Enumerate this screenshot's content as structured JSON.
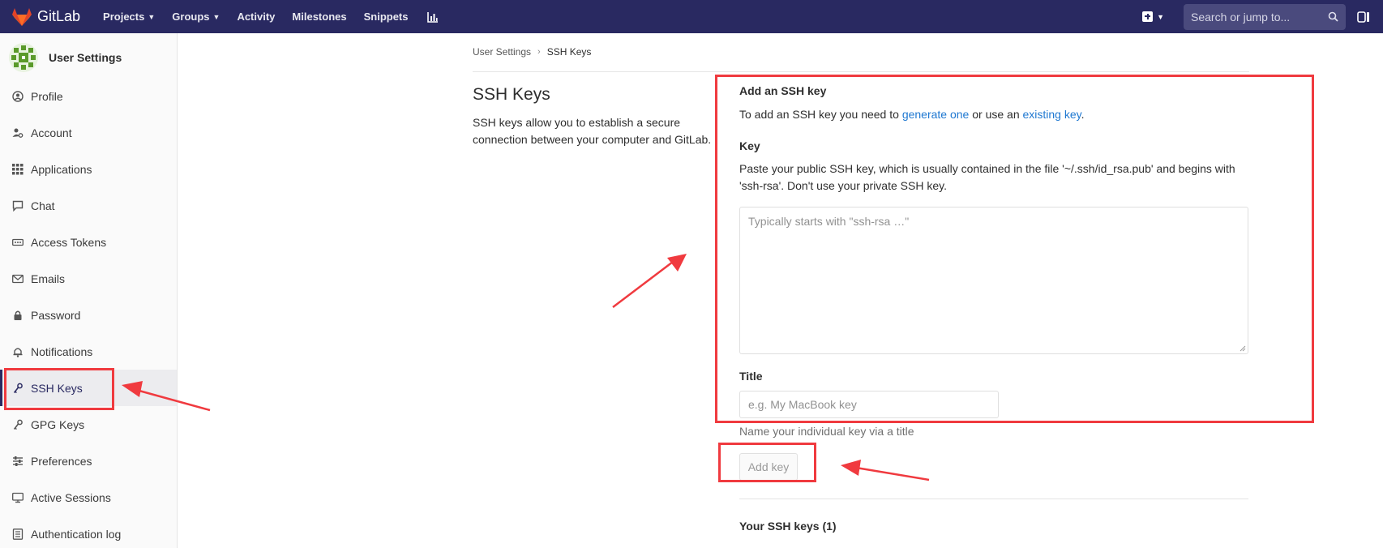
{
  "topnav": {
    "brand": "GitLab",
    "links": [
      "Projects",
      "Groups",
      "Activity",
      "Milestones",
      "Snippets"
    ],
    "search_placeholder": "Search or jump to..."
  },
  "sidebar": {
    "title": "User Settings",
    "items": [
      {
        "label": "Profile",
        "icon": "profile-icon"
      },
      {
        "label": "Account",
        "icon": "account-icon"
      },
      {
        "label": "Applications",
        "icon": "applications-icon"
      },
      {
        "label": "Chat",
        "icon": "chat-icon"
      },
      {
        "label": "Access Tokens",
        "icon": "access-tokens-icon"
      },
      {
        "label": "Emails",
        "icon": "email-icon"
      },
      {
        "label": "Password",
        "icon": "lock-icon"
      },
      {
        "label": "Notifications",
        "icon": "bell-icon"
      },
      {
        "label": "SSH Keys",
        "icon": "key-icon",
        "active": true
      },
      {
        "label": "GPG Keys",
        "icon": "key-icon"
      },
      {
        "label": "Preferences",
        "icon": "preferences-icon"
      },
      {
        "label": "Active Sessions",
        "icon": "monitor-icon"
      },
      {
        "label": "Authentication log",
        "icon": "log-icon"
      }
    ]
  },
  "breadcrumb": {
    "parent": "User Settings",
    "current": "SSH Keys"
  },
  "main": {
    "title": "SSH Keys",
    "description": "SSH keys allow you to establish a secure connection between your computer and GitLab.",
    "form": {
      "heading": "Add an SSH key",
      "help_prefix": "To add an SSH key you need to ",
      "help_link1": "generate one",
      "help_middle": " or use an ",
      "help_link2": "existing key",
      "help_suffix": ".",
      "key_label": "Key",
      "key_help": "Paste your public SSH key, which is usually contained in the file '~/.ssh/id_rsa.pub' and begins with 'ssh-rsa'. Don't use your private SSH key.",
      "key_placeholder": "Typically starts with \"ssh-rsa …\"",
      "title_label": "Title",
      "title_placeholder": "e.g. My MacBook key",
      "title_help": "Name your individual key via a title",
      "submit_label": "Add key"
    },
    "your_keys_heading": "Your SSH keys (1)"
  },
  "colors": {
    "navbar": "#292961",
    "link": "#1f78d1",
    "annotation": "#f03a3f"
  }
}
